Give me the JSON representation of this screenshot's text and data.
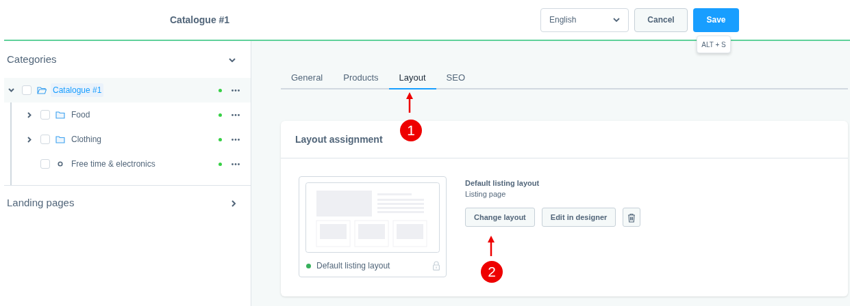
{
  "header": {
    "title": "Catalogue #1",
    "language": "English",
    "cancel": "Cancel",
    "save": "Save",
    "save_tooltip": "ALT + S"
  },
  "sidebar": {
    "categories_title": "Categories",
    "categories_expanded": true,
    "tree": [
      {
        "label": "Catalogue #1",
        "kind": "folder",
        "selected": true,
        "expanded": true,
        "checked": false,
        "active": true,
        "children": [
          {
            "label": "Food",
            "kind": "folder",
            "selected": false,
            "expanded": false,
            "checked": false,
            "active": true
          },
          {
            "label": "Clothing",
            "kind": "folder",
            "selected": false,
            "expanded": false,
            "checked": false,
            "active": true
          },
          {
            "label": "Free time & electronics",
            "kind": "leaf",
            "selected": false,
            "checked": false,
            "active": true
          }
        ]
      }
    ],
    "landing_title": "Landing pages",
    "landing_expanded": false
  },
  "tabs": [
    {
      "label": "General",
      "selected": false
    },
    {
      "label": "Products",
      "selected": false
    },
    {
      "label": "Layout",
      "selected": true
    },
    {
      "label": "SEO",
      "selected": false
    }
  ],
  "layout_card": {
    "title": "Layout assignment",
    "preview_label": "Default listing layout",
    "preview_active": true,
    "layout_name": "Default listing layout",
    "layout_type": "Listing page",
    "buttons": [
      "Change layout",
      "Edit in designer"
    ]
  },
  "annotations": [
    {
      "label": "1"
    },
    {
      "label": "2"
    }
  ]
}
